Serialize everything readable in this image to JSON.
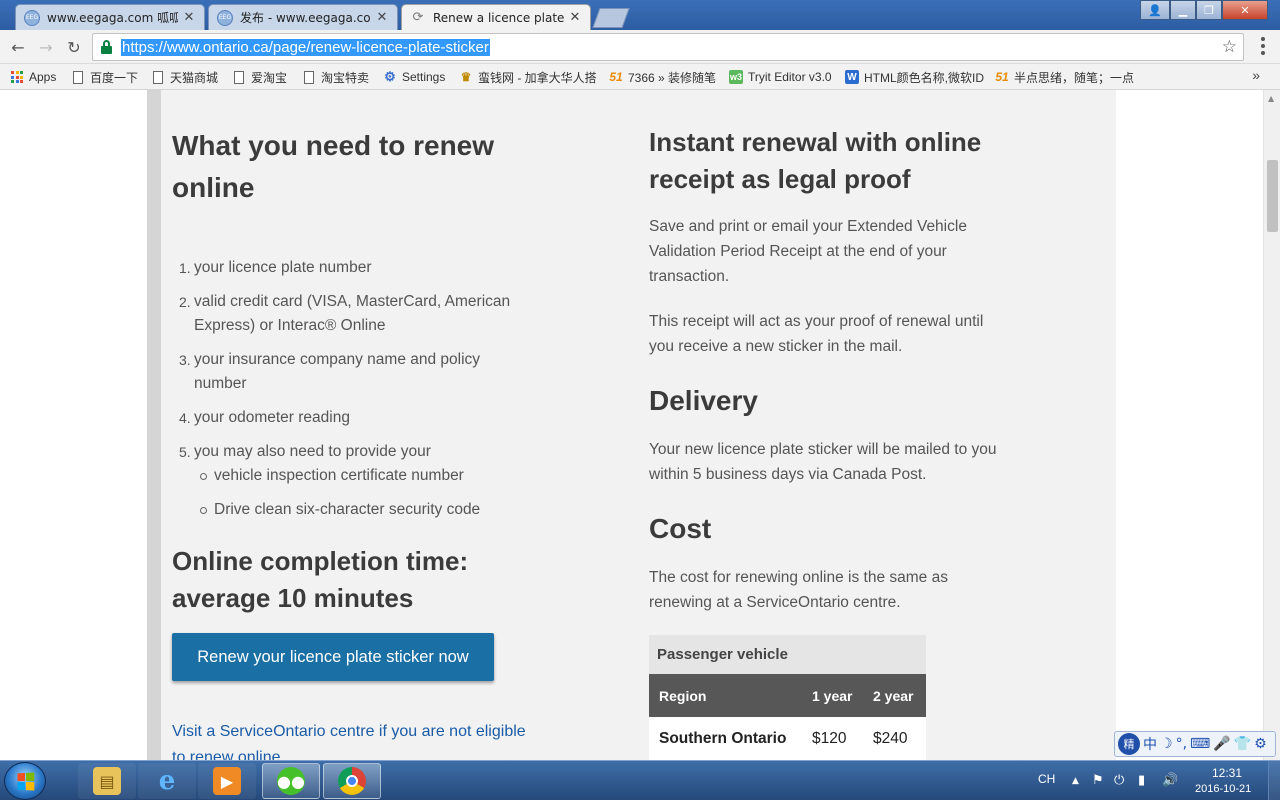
{
  "browser": {
    "tabs": [
      {
        "title": "www.eegaga.com 呱呱唧",
        "favicon": "eegaga-icon",
        "active": false
      },
      {
        "title": "发布 - www.eegaga.com",
        "favicon": "eegaga-icon",
        "active": false
      },
      {
        "title": "Renew a licence plate stic",
        "favicon": "loading-icon",
        "active": true
      }
    ],
    "favicon_text": "EEG",
    "close_glyph": "✕",
    "url": "https://www.ontario.ca/page/renew-licence-plate-sticker",
    "bookmarks": [
      {
        "label": "Apps",
        "icon": "apps-grid-icon"
      },
      {
        "label": "百度一下",
        "icon": "page-icon"
      },
      {
        "label": "天猫商城",
        "icon": "page-icon"
      },
      {
        "label": "爱淘宝",
        "icon": "page-icon"
      },
      {
        "label": "淘宝特卖",
        "icon": "page-icon"
      },
      {
        "label": "Settings",
        "icon": "settings-icon"
      },
      {
        "label": "蛮钱网 - 加拿大华人搭",
        "icon": "wing-icon"
      },
      {
        "label": "7366 » 装修随笔",
        "icon": "51-icon"
      },
      {
        "label": "Tryit Editor v3.0",
        "icon": "tryit-icon"
      },
      {
        "label": "HTML颜色名称,微软ID",
        "icon": "w-icon"
      },
      {
        "label": "半点思绪，随笔；一点",
        "icon": "51-icon"
      }
    ],
    "bookmark_icon_text": {
      "b51": "51",
      "tryit": "w3",
      "w": "W"
    },
    "accent_color": "#3399ff"
  },
  "page": {
    "left": {
      "heading_line1": "What you need to renew",
      "heading_line2": "online",
      "list": [
        {
          "num": "1.",
          "line1": "your licence plate number",
          "line2": ""
        },
        {
          "num": "2.",
          "line1": "valid credit card (VISA, MasterCard, American",
          "line2": "Express) or Interac® Online"
        },
        {
          "num": "3.",
          "line1": "your insurance company name and policy",
          "line2": "number"
        },
        {
          "num": "4.",
          "line1": "your odometer reading",
          "line2": ""
        },
        {
          "num": "5.",
          "line1": "you may also need to provide your",
          "line2": ""
        }
      ],
      "sublist": [
        "vehicle inspection certificate number",
        "Drive clean six-character security code"
      ],
      "completion_line1": "Online completion time:",
      "completion_line2": "average 10 minutes",
      "renew_button": "Renew your licence plate sticker now",
      "link_line1": "Visit a ServiceOntario centre if you are not eligible",
      "link_line2": "to renew online"
    },
    "right": {
      "instant_line1": "Instant renewal with online",
      "instant_line2": "receipt as legal proof",
      "instant_p1_l1": "Save and print or email your Extended Vehicle",
      "instant_p1_l2": "Validation Period Receipt at the end of your",
      "instant_p1_l3": "transaction.",
      "instant_p2_l1": "This receipt will act as your proof of renewal until",
      "instant_p2_l2": "you receive a new sticker in the mail.",
      "delivery_heading": "Delivery",
      "delivery_l1": "Your new licence plate sticker will be mailed to you",
      "delivery_l2": "within 5 business days via Canada Post.",
      "cost_heading": "Cost",
      "cost_l1": "The cost for renewing online is the same as",
      "cost_l2": "renewing at a ServiceOntario centre.",
      "table": {
        "caption": "Passenger vehicle",
        "headers": [
          "Region",
          "1 year",
          "2 year"
        ],
        "rows": [
          [
            "Southern Ontario",
            "$120",
            "$240"
          ]
        ]
      }
    },
    "brand_button_color": "#1a6fa5",
    "link_color": "#1a5ca8"
  },
  "ime": {
    "logo": "精",
    "glyphs": [
      "中",
      "☽",
      "°,",
      "⌨",
      "🎤",
      "👕",
      "⚙"
    ]
  },
  "taskbar": {
    "language": "CH",
    "time": "12:31",
    "date": "2016-10-21",
    "apps": [
      "file-explorer-icon",
      "internet-explorer-icon",
      "media-player-icon",
      "wechat-icon",
      "chrome-icon"
    ]
  }
}
